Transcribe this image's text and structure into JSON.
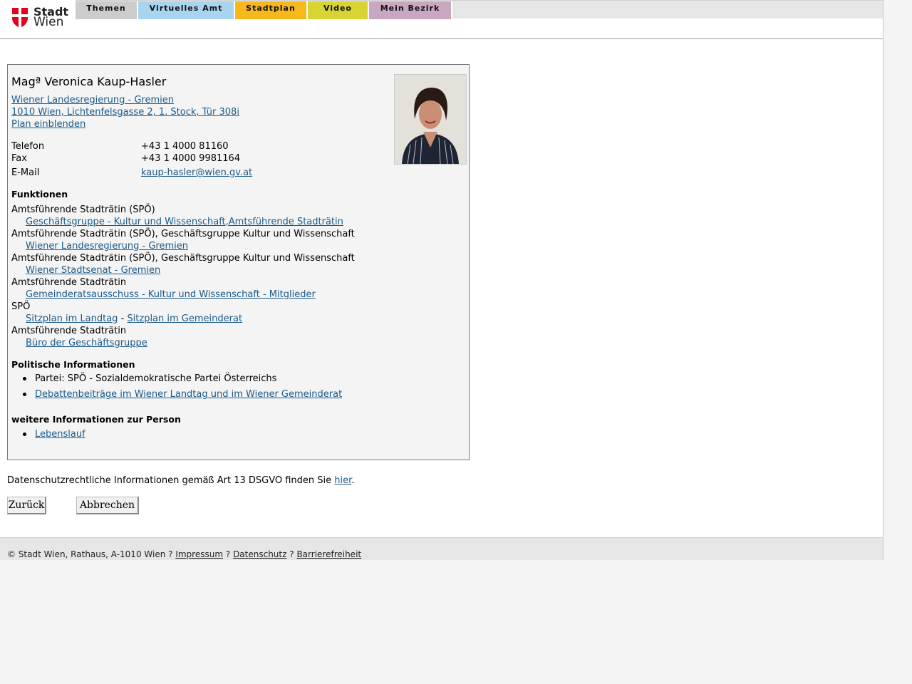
{
  "header": {
    "logo_top": "Stadt",
    "logo_bottom": "Wien",
    "tabs": [
      {
        "label": "Themen",
        "color": "#cccccc"
      },
      {
        "label": "Virtuelles Amt",
        "color": "#a8d4f0"
      },
      {
        "label": "Stadtplan",
        "color": "#f6b81c"
      },
      {
        "label": "Video",
        "color": "#d7d433"
      },
      {
        "label": "Mein Bezirk",
        "color": "#c9a7c0"
      }
    ]
  },
  "person": {
    "name": "Magª Veronica Kaup-Hasler",
    "org_link": "Wiener Landesregierung - Gremien",
    "address_link": "1010 Wien, Lichtenfelsgasse 2, 1. Stock, Tür 308i",
    "plan_link": "Plan einblenden",
    "phone_label": "Telefon",
    "phone": "+43 1 4000 81160",
    "fax_label": "Fax",
    "fax": "+43 1 4000 9981164",
    "email_label": "E-Mail",
    "email": "kaup-hasler@wien.gv.at"
  },
  "funktionen": {
    "title": "Funktionen",
    "items": [
      {
        "role": "Amtsführende Stadträtin (SPÖ)",
        "link": "Geschäftsgruppe - Kultur und Wissenschaft,Amtsführende Stadträtin"
      },
      {
        "role": "Amtsführende Stadträtin (SPÖ), Geschäftsgruppe Kultur und Wissenschaft",
        "link": "Wiener Landesregierung - Gremien"
      },
      {
        "role": "Amtsführende Stadträtin (SPÖ), Geschäftsgruppe Kultur und Wissenschaft",
        "link": "Wiener Stadtsenat - Gremien"
      },
      {
        "role": "Amtsführende Stadträtin",
        "link": "Gemeinderatsausschuss - Kultur und Wissenschaft - Mitglieder"
      },
      {
        "role": "SPÖ",
        "link": "Sitzplan im Landtag",
        "separator": "-",
        "link2": "Sitzplan im Gemeinderat"
      },
      {
        "role": "Amtsführende Stadträtin",
        "link": "Büro der Geschäftsgruppe"
      }
    ]
  },
  "politisch": {
    "title": "Politische Informationen",
    "party": "Partei: SPÖ - Sozialdemokratische Partei Österreichs",
    "debates_link": "Debattenbeiträge im Wiener Landtag und im Wiener Gemeinderat"
  },
  "weitere": {
    "title": "weitere Informationen zur Person",
    "cv_link": "Lebenslauf"
  },
  "privacy": {
    "text": "Datenschutzrechtliche Informationen gemäß Art 13 DSGVO finden Sie",
    "link": "hier",
    "end": "."
  },
  "buttons": {
    "back": "Zurück",
    "cancel": "Abbrechen"
  },
  "footer": {
    "copyright": "© Stadt Wien, Rathaus, A-1010 Wien ?",
    "impressum": "Impressum",
    "sep1": "?",
    "datenschutz": "Datenschutz",
    "sep2": "?",
    "barrierefreiheit": "Barrierefreiheit"
  }
}
